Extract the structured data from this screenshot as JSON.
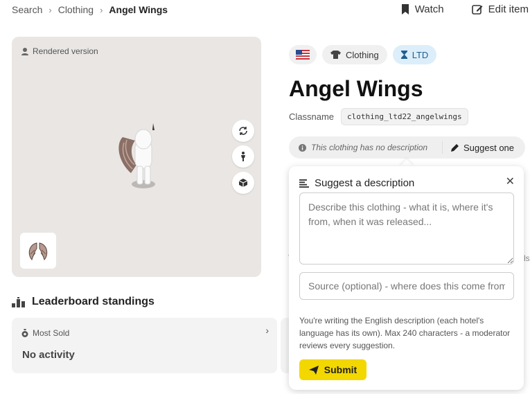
{
  "breadcrumb": {
    "items": [
      "Search",
      "Clothing"
    ],
    "current": "Angel Wings"
  },
  "top_actions": {
    "watch": "Watch",
    "edit": "Edit item"
  },
  "viewer": {
    "label": "Rendered version"
  },
  "leaderboard": {
    "title": "Leaderboard standings",
    "card_label": "Most Sold",
    "card_value": "No activity"
  },
  "chips": {
    "category": "Clothing",
    "rarity": "LTD"
  },
  "item": {
    "title": "Angel Wings",
    "classname_label": "Classname",
    "classname": "clothing_ltd22_angelwings"
  },
  "description_bar": {
    "empty_text": "This clothing has no description",
    "suggest_label": "Suggest one"
  },
  "suggest_popover": {
    "title": "Suggest a description",
    "description_placeholder": "Describe this clothing - what it is, where it's from, when it was released...",
    "source_placeholder": "Source (optional) - where does this come from?",
    "help_text": "You're writing the English description (each hotel's language has its own). Max 240 characters - a moderator reviews every suggestion.",
    "submit_label": "Submit"
  },
  "colors": {
    "accent_yellow": "#f3d700",
    "ltd_chip_bg": "#dceefa",
    "viewer_bg": "#e9e6e4"
  }
}
